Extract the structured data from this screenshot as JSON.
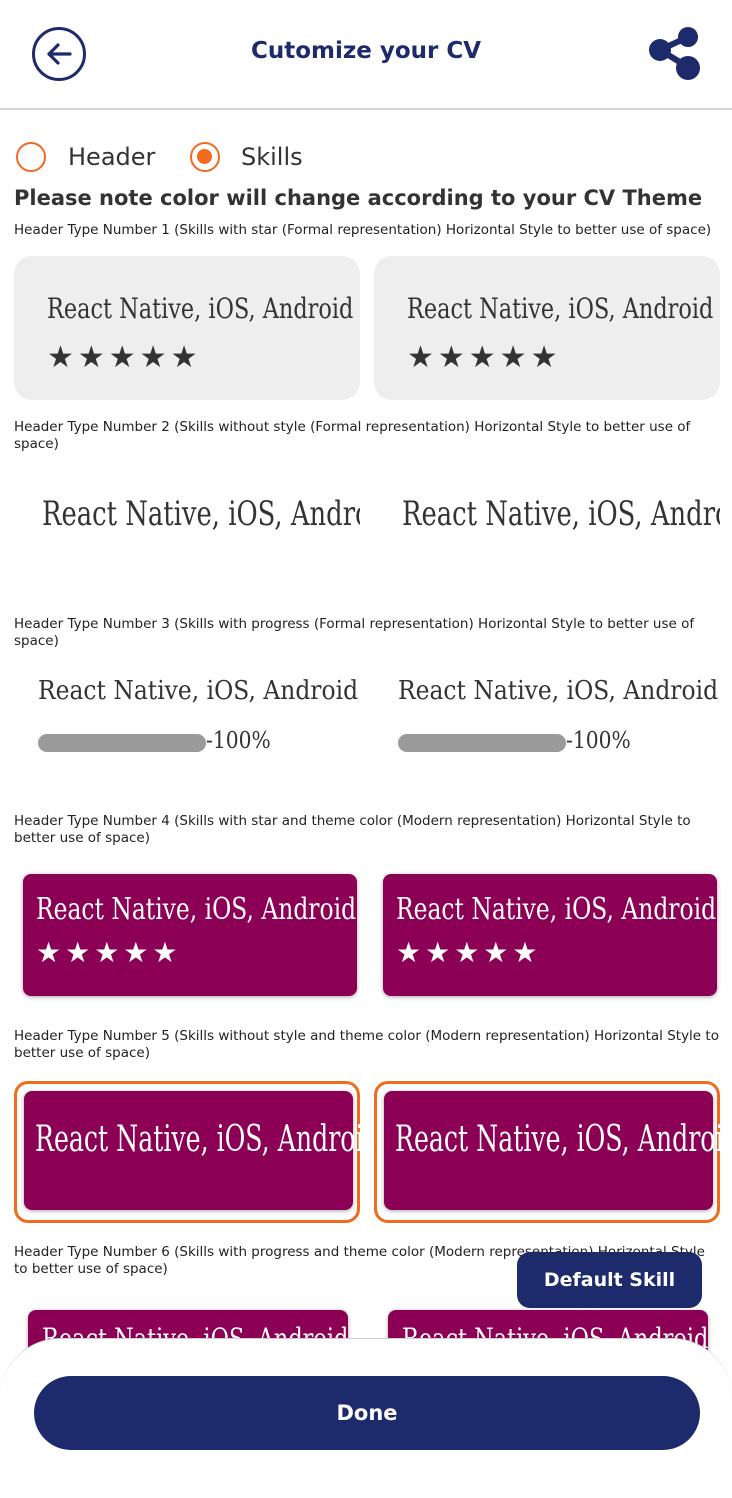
{
  "header": {
    "title": "Cutomize your CV"
  },
  "tabs": {
    "header_label": "Header",
    "skills_label": "Skills",
    "selected": "Skills"
  },
  "note": "Please note color will change according to your CV Theme",
  "sections": [
    {
      "label": "Header Type Number 1 (Skills with star (Formal representation) Horizontal Style to better use of space)"
    },
    {
      "label": "Header Type Number 2 (Skills without style (Formal representation) Horizontal Style to better use of space)"
    },
    {
      "label": "Header Type Number 3 (Skills with progress (Formal representation) Horizontal Style to better use of space)"
    },
    {
      "label": "Header Type Number 4 (Skills with star and theme color (Modern representation) Horizontal Style to better use of space)"
    },
    {
      "label": "Header Type Number 5 (Skills without style and theme color (Modern representation) Horizontal Style to better use of space)"
    },
    {
      "label": "Header Type Number 6 (Skills with progress and theme color (Modern representation) Horizontal Style to better use of space)"
    }
  ],
  "preview": {
    "skill_text": "React Native, iOS, Android",
    "stars": "★★★★★",
    "progress_text": "-100%",
    "progress_value": 1.0,
    "theme_color": "#8b0055",
    "selected_section": 5
  },
  "buttons": {
    "default_skill": "Default Skill",
    "done": "Done"
  },
  "colors": {
    "primary": "#1d2a6b",
    "accent": "#f36a1f"
  }
}
